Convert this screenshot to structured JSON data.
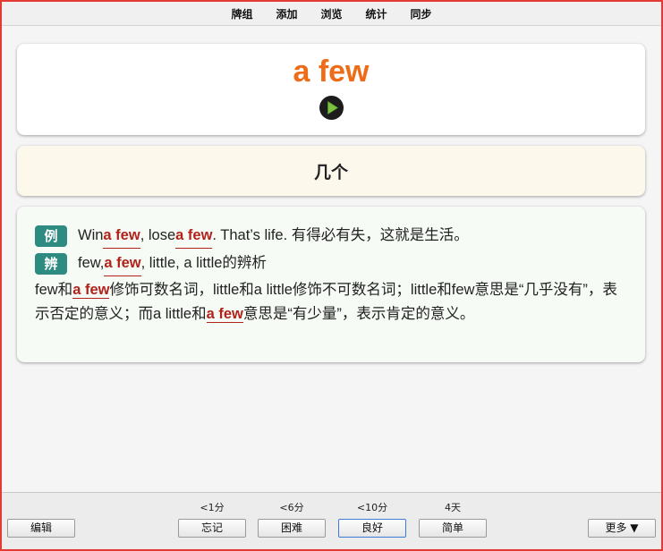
{
  "nav": [
    "牌组",
    "添加",
    "浏览",
    "统计",
    "同步"
  ],
  "card": {
    "word": "a few",
    "play_icon": "play-icon",
    "meaning": "几个",
    "example": {
      "tag": "例",
      "pre": "Win ",
      "hl1": "a few",
      "mid": ", lose ",
      "hl2": "a few",
      "post": ". That’s life. 有得必有失，这就是生活。"
    },
    "distinguish": {
      "tag": "辨",
      "pre": "few, ",
      "hl": "a few",
      "post": ", little, a little的辨析"
    },
    "explanation": {
      "p1": "few和",
      "hl1": "a few",
      "p2": "修饰可数名词，little和a little修饰不可数名词；little和few意思是“几乎没有”，表示否定的意义；而a little和",
      "hl2": "a few",
      "p3": "意思是“有少量”，表示肯定的意义。"
    }
  },
  "bottom": {
    "edit": "编辑",
    "more": "更多 ▼",
    "answers": [
      {
        "time": "<1分",
        "label": "忘记"
      },
      {
        "time": "<6分",
        "label": "困难"
      },
      {
        "time": "<10分",
        "label": "良好"
      },
      {
        "time": "4天",
        "label": "简单"
      }
    ]
  },
  "colors": {
    "word": "#ee6c18",
    "highlight": "#b0221a",
    "tag": "#2e8b82",
    "frame": "#e53935"
  }
}
